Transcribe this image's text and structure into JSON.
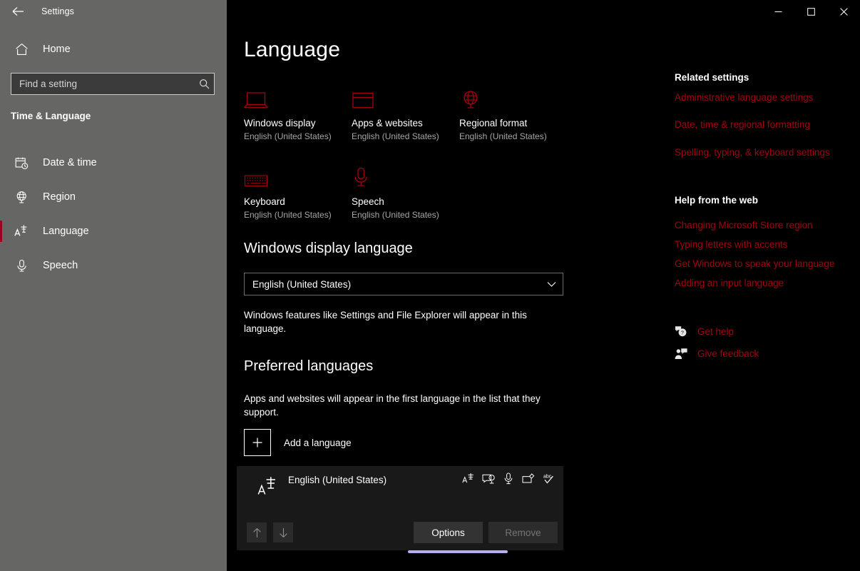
{
  "window": {
    "app_title": "Settings",
    "back_icon": "back-arrow-icon",
    "minimize_label": "─",
    "maximize_label": "☐",
    "close_label": "✕"
  },
  "sidebar": {
    "home_label": "Home",
    "home_icon": "home-icon",
    "search": {
      "placeholder": "Find a setting",
      "value": "",
      "icon": "search-icon"
    },
    "group_title": "Time & Language",
    "items": [
      {
        "label": "Date & time",
        "icon": "calendar-clock-icon",
        "selected": false
      },
      {
        "label": "Region",
        "icon": "globe-stand-icon",
        "selected": false
      },
      {
        "label": "Language",
        "icon": "language-icon",
        "selected": true
      },
      {
        "label": "Speech",
        "icon": "microphone-icon",
        "selected": false
      }
    ],
    "accent_color": "#9b0020",
    "background_color": "#666665"
  },
  "main": {
    "page_title": "Language",
    "summary_tiles": [
      {
        "name": "Windows display",
        "value": "English (United States)",
        "icon": "laptop-icon"
      },
      {
        "name": "Apps & websites",
        "value": "English (United States)",
        "icon": "window-icon"
      },
      {
        "name": "Regional format",
        "value": "English (United States)",
        "icon": "globe-stand-icon"
      },
      {
        "name": "Keyboard",
        "value": "English (United States)",
        "icon": "keyboard-icon"
      },
      {
        "name": "Speech",
        "value": "English (United States)",
        "icon": "microphone-icon"
      }
    ],
    "display_language": {
      "heading": "Windows display language",
      "selected": "English (United States)",
      "chevron_icon": "chevron-down-icon",
      "description": "Windows features like Settings and File Explorer will appear in this language."
    },
    "preferred_languages": {
      "heading": "Preferred languages",
      "description": "Apps and websites will appear in the first language in the list that they support.",
      "add_label": "Add a language",
      "add_icon": "plus-icon",
      "card": {
        "name": "English (United States)",
        "icon": "language-icon",
        "features": [
          "language-pack-icon",
          "display-language-icon",
          "speech-icon",
          "handwriting-icon",
          "spellcheck-icon"
        ],
        "move_up_icon": "arrow-up-icon",
        "move_down_icon": "arrow-down-icon",
        "options_label": "Options",
        "remove_label": "Remove",
        "remove_disabled": true
      }
    },
    "accent_color": "#a4000f",
    "background_color": "#000000"
  },
  "rail": {
    "related_heading": "Related settings",
    "related_links": [
      "Administrative language settings",
      "Date, time & regional formatting",
      "Spelling, typing, & keyboard settings"
    ],
    "help_heading": "Help from the web",
    "help_links": [
      "Changing Microsoft Store region",
      "Typing letters with accents",
      "Get Windows to speak your language",
      "Adding an input language"
    ],
    "get_help_label": "Get help",
    "get_help_icon": "help-chat-icon",
    "give_feedback_label": "Give feedback",
    "give_feedback_icon": "feedback-person-icon"
  }
}
